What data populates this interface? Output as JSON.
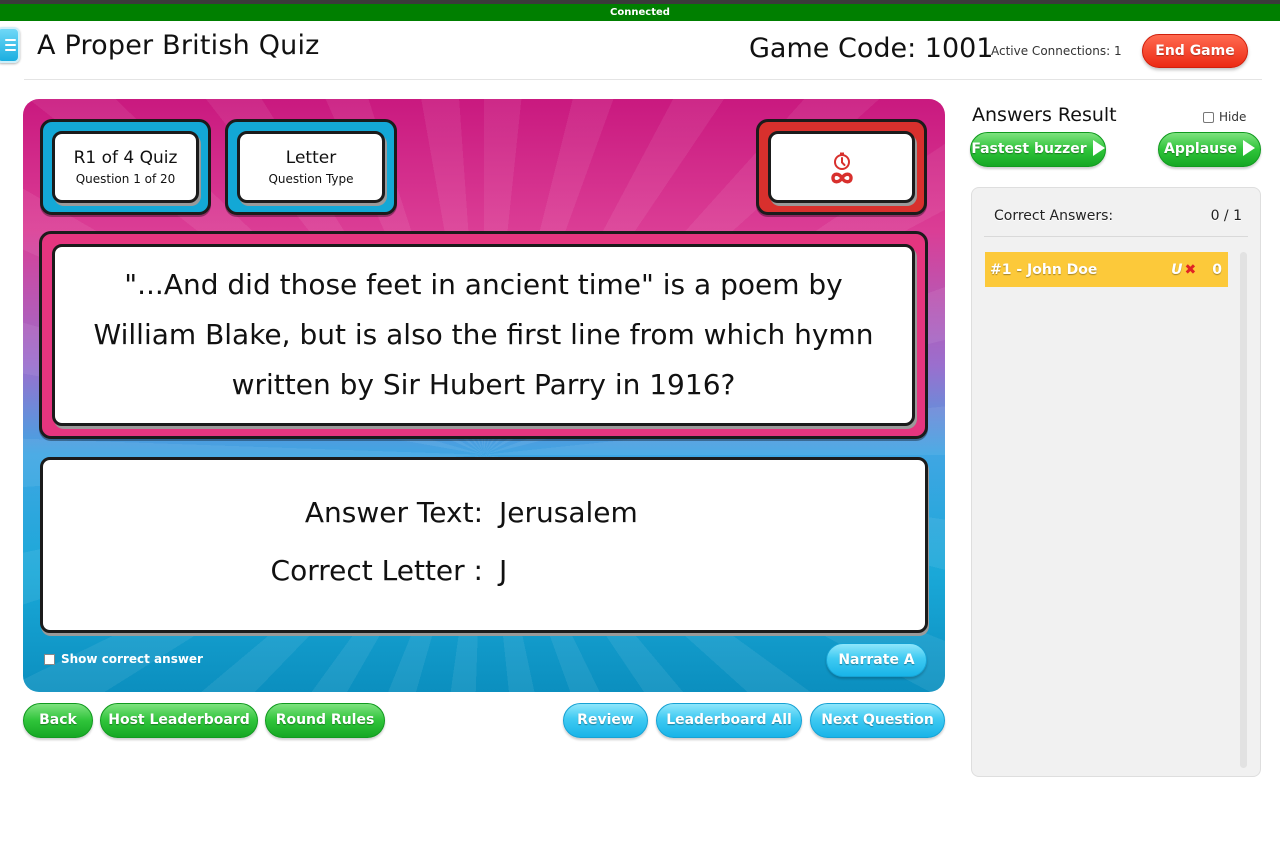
{
  "status_bar": {
    "text": "Connected",
    "color": "#007f00"
  },
  "header": {
    "menu_icon": "hamburger-menu-icon",
    "title": "A Proper British Quiz",
    "game_code": "Game Code: 1001",
    "active_connections": "Active Connections: 1",
    "end_game_label": "End Game"
  },
  "stage": {
    "round_tile": {
      "main": "R1 of 4 Quiz",
      "sub": "Question 1 of 20"
    },
    "type_tile": {
      "main": "Letter",
      "sub": "Question Type"
    },
    "timer_tile": {
      "clock_icon": "clock-icon",
      "value": "∞",
      "value_icon": "infinity-icon"
    },
    "question": "\"...And did those feet in ancient time\" is a poem by William Blake, but is also the first line from which hymn written by Sir Hubert Parry in 1916?",
    "answer": {
      "text_label": "Answer Text:",
      "text_value": "Jerusalem",
      "letter_label": "Correct Letter :",
      "letter_value": "J"
    },
    "show_correct_answer": {
      "label": "Show correct answer",
      "checked": false
    },
    "narrate_label": "Narrate A"
  },
  "bottom_buttons": {
    "back": "Back",
    "host_leaderboard": "Host Leaderboard",
    "round_rules": "Round Rules",
    "review": "Review",
    "leaderboard_all": "Leaderboard All",
    "next_question": "Next Question"
  },
  "results": {
    "title": "Answers Result",
    "hide_label": "Hide",
    "hide_checked": false,
    "fastest_buzzer_label": "Fastest buzzer",
    "applause_label": "Applause",
    "correct_answers_label": "Correct Answers:",
    "correct_answers_value": "0 / 1",
    "rows": [
      {
        "name": "#1 - John Doe",
        "badge": "U",
        "status_icon": "cross-icon",
        "status_glyph": "✖",
        "score": "0"
      }
    ]
  },
  "colors": {
    "end_game": "#ec2a13",
    "button_green": "#2fc43a",
    "button_blue": "#19b4e8",
    "tile_blue": "#13a8d6",
    "tile_red": "#d8302d",
    "question_frame": "#e5357f",
    "result_row": "#fcc93a"
  }
}
